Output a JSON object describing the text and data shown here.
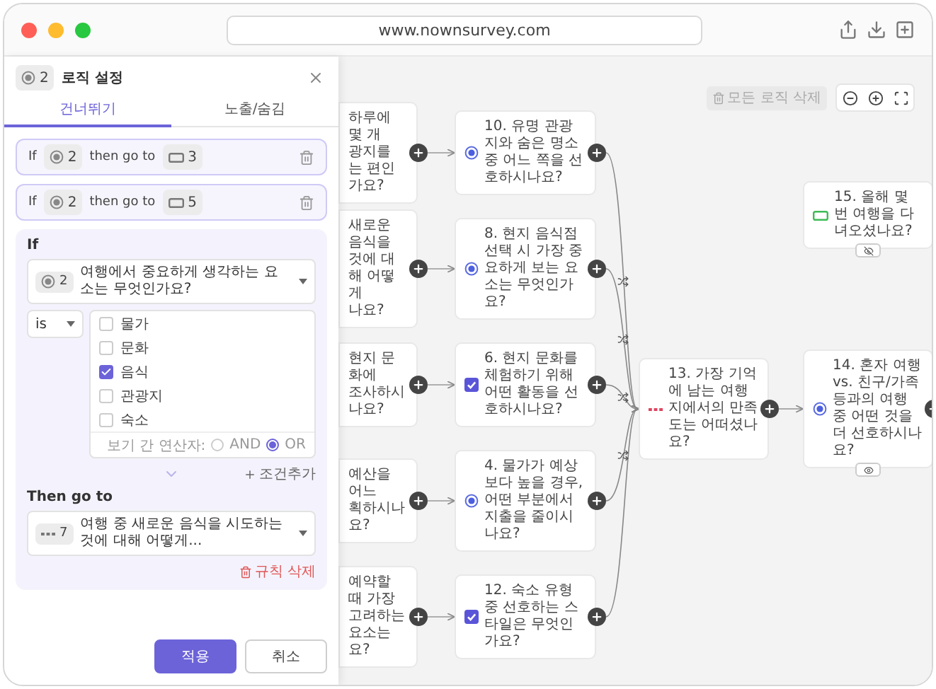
{
  "browser": {
    "url": "www.nownsurvey.com"
  },
  "panel": {
    "chip": {
      "kind": "radio",
      "number": "2"
    },
    "title": "로직 설정",
    "tabs": [
      {
        "label": "건너뛰기",
        "selected": true
      },
      {
        "label": "노출/숨김",
        "selected": false
      }
    ],
    "rules": [
      {
        "if": "If",
        "source": {
          "kind": "radio",
          "number": "2"
        },
        "then": "then go to",
        "target": {
          "kind": "short",
          "number": "3"
        }
      },
      {
        "if": "If",
        "source": {
          "kind": "radio",
          "number": "2"
        },
        "then": "then go to",
        "target": {
          "kind": "short",
          "number": "5"
        }
      }
    ],
    "editor": {
      "if": "If",
      "question": {
        "kind": "radio",
        "number": "2",
        "text": "여행에서 중요하게 생각하는 요소는 무엇인가요?"
      },
      "operator": "is",
      "options": [
        {
          "label": "물가",
          "checked": false
        },
        {
          "label": "문화",
          "checked": false
        },
        {
          "label": "음식",
          "checked": true
        },
        {
          "label": "관광지",
          "checked": false
        },
        {
          "label": "숙소",
          "checked": false
        }
      ],
      "combinator": {
        "label": "보기 간 연산자:",
        "choices": [
          {
            "label": "AND",
            "selected": false
          },
          {
            "label": "OR",
            "selected": true
          }
        ]
      },
      "add_condition": "조건추가",
      "then": "Then go to",
      "target": {
        "kind": "dots",
        "number": "7",
        "text": "여행 중 새로운 음식을 시도하는 것에 대해 어떻게..."
      },
      "delete_rule": "규칙 삭제"
    },
    "buttons": [
      {
        "label": "적용",
        "kind": "primary"
      },
      {
        "label": "취소",
        "kind": "secondary"
      }
    ]
  },
  "canvas": {
    "delete_all": {
      "label": "모든 로직 삭제",
      "disabled": true
    },
    "partial_nodes": [
      {
        "lines": [
          "하루에 몇 개",
          "광지를",
          "는 편인가요?"
        ]
      },
      {
        "lines": [
          "새로운 음식을",
          "것에 대해 어떻게",
          "나요?"
        ]
      },
      {
        "lines": [
          "현지 문화에",
          "조사하시나요?"
        ]
      },
      {
        "lines": [
          "예산을 어느",
          "획하시나요?"
        ]
      },
      {
        "lines": [
          "예약할 때 가장",
          "고려하는 요소는",
          "요?"
        ]
      }
    ],
    "nodes": [
      {
        "kind": "radio",
        "text": "10. 유명 관광지와 숨은 명소 중 어느 쪽을 선호하시나요?",
        "add_button": true
      },
      {
        "kind": "radio",
        "text": "8. 현지 음식점 선택 시 가장 중요하게 보는 요소는 무엇인가요?",
        "add_button": true
      },
      {
        "kind": "checkbox",
        "text": "6. 현지 문화를 체험하기 위해 어떤 활동을 선호하시나요?",
        "add_button": true
      },
      {
        "kind": "radio",
        "text": "4. 물가가 예상보다 높을 경우, 어떤 부분에서 지출을 줄이시나요?",
        "add_button": true
      },
      {
        "kind": "checkbox",
        "text": "12. 숙소 유형 중 선호하는 스타일은 무엇인가요?",
        "add_button": true
      },
      {
        "kind": "dots",
        "text": "13. 가장 기억에 남는 여행지에서의 만족도는 어떠셨나요?",
        "add_button": true
      },
      {
        "kind": "short",
        "text": "15. 올해 몇 번 여행을 다녀오셨나요?",
        "add_button": false,
        "show_badge": true,
        "hidden": true
      },
      {
        "kind": "radio",
        "text": "14. 혼자 여행 vs. 친구/가족 등과의 여행 중 어떤 것을 더 선호하시나요?",
        "add_button": true,
        "show_badge": true,
        "hidden": false
      }
    ]
  }
}
